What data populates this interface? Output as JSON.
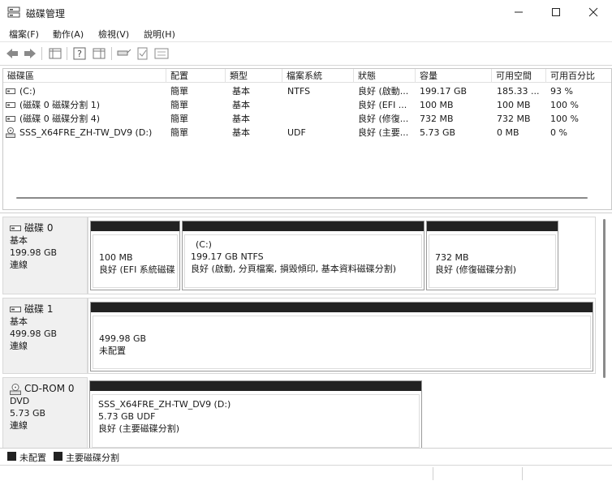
{
  "window": {
    "title": "磁碟管理"
  },
  "menu": {
    "file": "檔案(F)",
    "action": "動作(A)",
    "view": "檢視(V)",
    "help": "說明(H)"
  },
  "columns": [
    "磁碟區",
    "配置",
    "類型",
    "檔案系統",
    "狀態",
    "容量",
    "可用空間",
    "可用百分比"
  ],
  "volumes": [
    {
      "name": "(C:)",
      "layout": "簡單",
      "type": "基本",
      "fs": "NTFS",
      "status": "良好 (啟動...",
      "capacity": "199.17 GB",
      "free": "185.33 ...",
      "pct": "93 %",
      "icon": "drive-icon"
    },
    {
      "name": "(磁碟 0 磁碟分割 1)",
      "layout": "簡單",
      "type": "基本",
      "fs": "",
      "status": "良好 (EFI ...",
      "capacity": "100 MB",
      "free": "100 MB",
      "pct": "100 %",
      "icon": "drive-icon"
    },
    {
      "name": "(磁碟 0 磁碟分割 4)",
      "layout": "簡單",
      "type": "基本",
      "fs": "",
      "status": "良好 (修復...",
      "capacity": "732 MB",
      "free": "732 MB",
      "pct": "100 %",
      "icon": "drive-icon"
    },
    {
      "name": "SSS_X64FRE_ZH-TW_DV9 (D:)",
      "layout": "簡單",
      "type": "基本",
      "fs": "UDF",
      "status": "良好 (主要...",
      "capacity": "5.73 GB",
      "free": "0 MB",
      "pct": "0 %",
      "icon": "cdrom-icon"
    }
  ],
  "disks": {
    "disk0": {
      "name": "磁碟 0",
      "type": "基本",
      "size": "199.98 GB",
      "state": "連線",
      "parts": [
        {
          "line1": "100 MB",
          "line2": "良好 (EFI 系統磁碟"
        },
        {
          "line0": "(C:)",
          "line1": "199.17 GB NTFS",
          "line2": "良好 (啟動, 分頁檔案, 損毀傾印, 基本資料磁碟分割)"
        },
        {
          "line1": "732 MB",
          "line2": "良好 (修復磁碟分割)"
        }
      ]
    },
    "disk1": {
      "name": "磁碟 1",
      "type": "基本",
      "size": "499.98 GB",
      "state": "連線",
      "parts": [
        {
          "line1": "499.98 GB",
          "line2": "未配置"
        }
      ]
    },
    "cdrom0": {
      "name": "CD-ROM 0",
      "type": "DVD",
      "size": "5.73 GB",
      "state": "連線",
      "parts": [
        {
          "line0": "SSS_X64FRE_ZH-TW_DV9  (D:)",
          "line1": "5.73 GB UDF",
          "line2": "良好 (主要磁碟分割)"
        }
      ]
    }
  },
  "legend": {
    "unallocated": "未配置",
    "primary": "主要磁碟分割"
  },
  "colors": {
    "partition_bar": "#222222",
    "unallocated_bar": "#222222"
  }
}
